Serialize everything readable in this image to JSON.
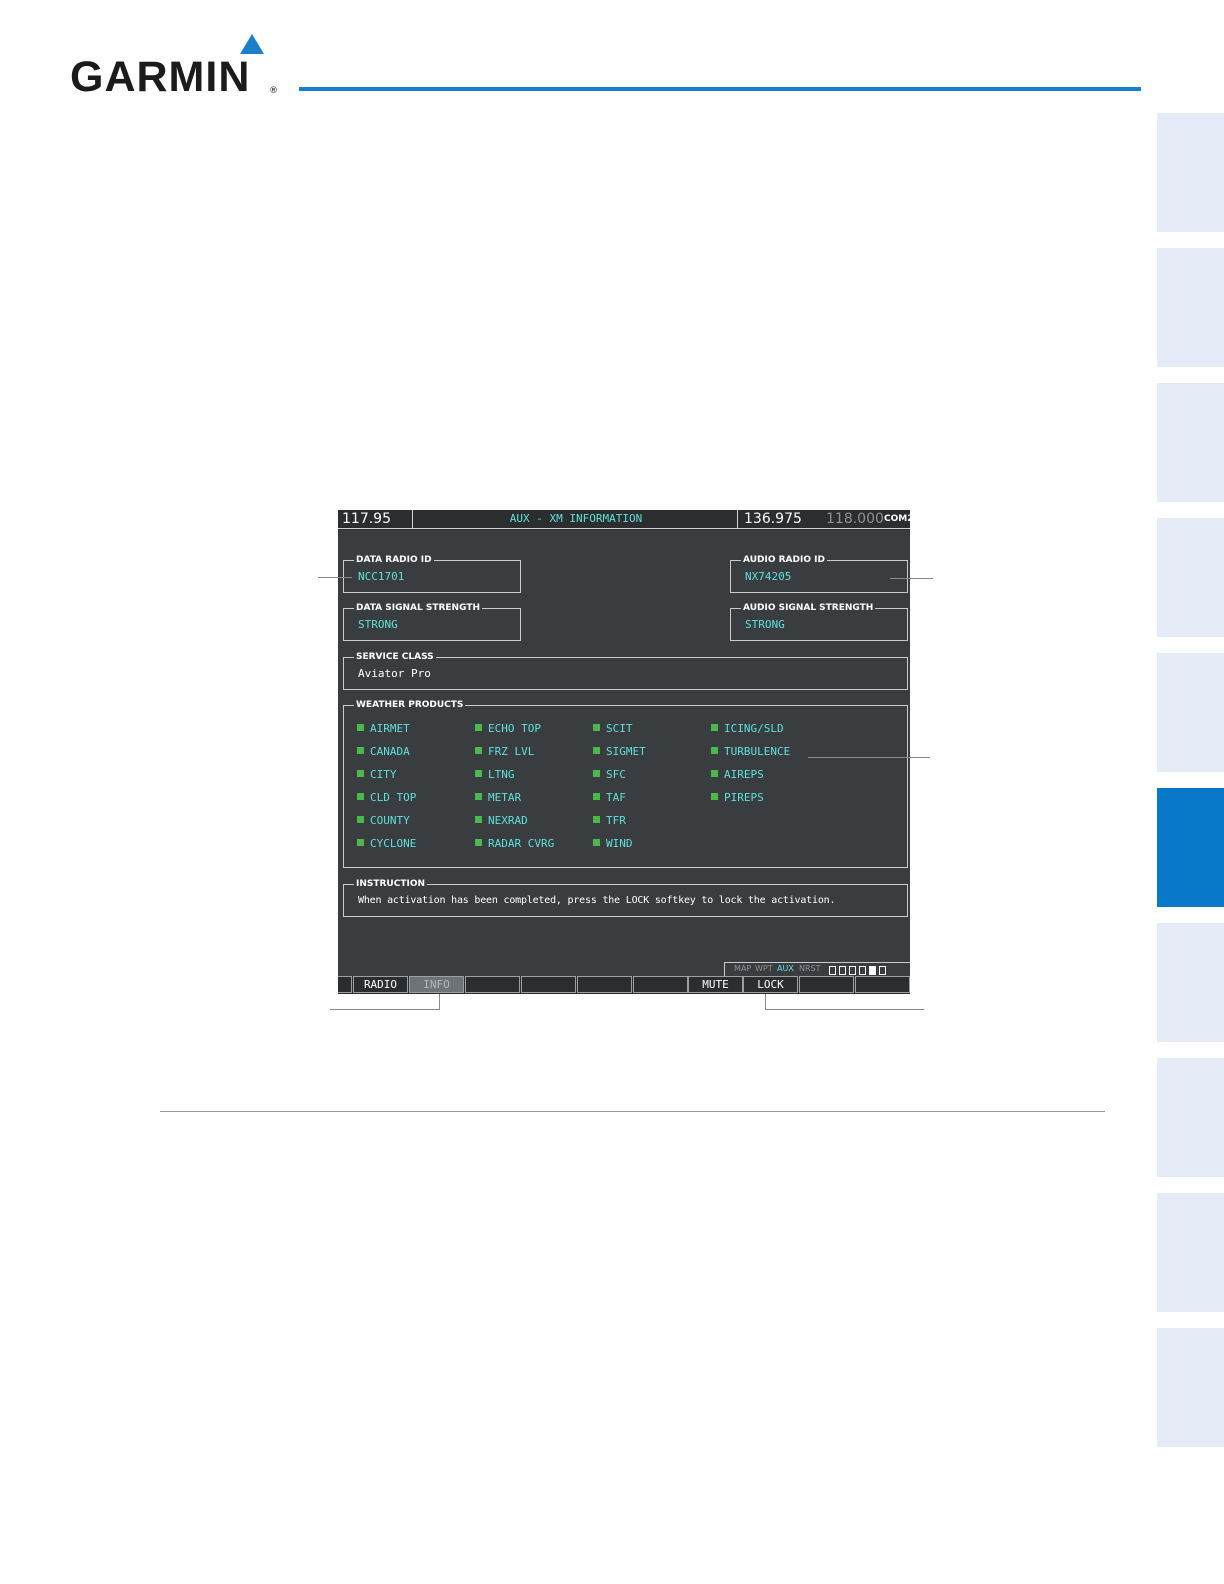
{
  "brand": {
    "name": "GARMIN",
    "registered": "®",
    "accent_color": "#1a7fc8"
  },
  "screen": {
    "nav_freq": "117.95",
    "title": "AUX - XM INFORMATION",
    "com_active": "136.975",
    "com_standby": "118.000",
    "com_label": "COM2",
    "data_radio_id": {
      "label": "DATA RADIO ID",
      "value": "NCC1701"
    },
    "data_signal": {
      "label": "DATA SIGNAL STRENGTH",
      "value": "STRONG"
    },
    "audio_radio_id": {
      "label": "AUDIO RADIO ID",
      "value": "NX74205"
    },
    "audio_signal": {
      "label": "AUDIO SIGNAL STRENGTH",
      "value": "STRONG"
    },
    "service_class": {
      "label": "SERVICE CLASS",
      "value": "Aviator Pro"
    },
    "weather_products": {
      "label": "WEATHER PRODUCTS",
      "columns": [
        [
          "AIRMET",
          "CANADA",
          "CITY",
          "CLD TOP",
          "COUNTY",
          "CYCLONE"
        ],
        [
          "ECHO TOP",
          "FRZ LVL",
          "LTNG",
          "METAR",
          "NEXRAD",
          "RADAR CVRG"
        ],
        [
          "SCIT",
          "SIGMET",
          "SFC",
          "TAF",
          "TFR",
          "WIND"
        ],
        [
          "ICING/SLD",
          "TURBULENCE",
          "AIREPS",
          "PIREPS"
        ]
      ],
      "indicator_color": "#4ab84a"
    },
    "instruction": {
      "label": "INSTRUCTION",
      "text": "When activation has been completed, press the LOCK softkey to lock the activation."
    },
    "page_nav": {
      "items": [
        "MAP",
        "WPT",
        "AUX",
        "NRST"
      ],
      "active": "AUX"
    },
    "softkeys": [
      "",
      "RADIO",
      "INFO",
      "",
      "",
      "",
      "",
      "MUTE",
      "LOCK",
      "",
      ""
    ],
    "softkey_selected": "INFO"
  }
}
